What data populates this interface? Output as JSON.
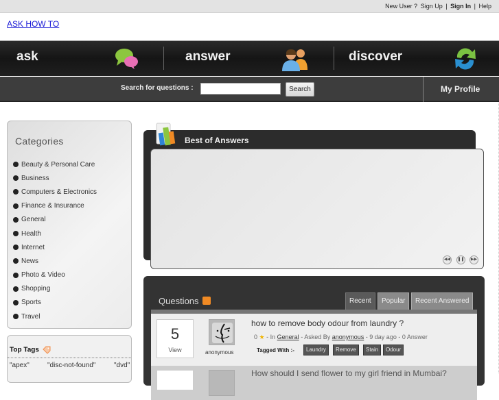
{
  "topbar": {
    "new_user": "New User ?",
    "sign_up": "Sign Up",
    "sep": "|",
    "sign_in": "Sign In",
    "help": "Help"
  },
  "brand": "ASK HOW TO",
  "nav": {
    "items": [
      {
        "label": "ask",
        "icon": "chat-bubbles-icon"
      },
      {
        "label": "answer",
        "icon": "users-icon"
      },
      {
        "label": "discover",
        "icon": "refresh-icon"
      }
    ]
  },
  "search": {
    "label": "Search for questions :",
    "value": "",
    "placeholder": "",
    "button": "Search",
    "profile": "My Profile"
  },
  "sidebar": {
    "categories_title": "Categories",
    "categories": [
      "Beauty & Personal Care",
      "Business",
      "Computers & Electronics",
      "Finance & Insurance",
      "General",
      "Health",
      "Internet",
      "News",
      "Photo & Video",
      "Shopping",
      "Sports",
      "Travel"
    ],
    "top_tags_title": "Top Tags",
    "top_tags": [
      "\"apex\"",
      "\"disc-not-found\"",
      "\"dvd\""
    ]
  },
  "best_of_answers": {
    "title": "Best of Answers",
    "controls": [
      "prev",
      "pause",
      "next"
    ]
  },
  "questions": {
    "title": "Questions",
    "tabs": [
      "Recent",
      "Popular",
      "Recent Answered"
    ],
    "active_tab": "Recent",
    "items": [
      {
        "views": "5",
        "views_label": "View",
        "user": "anonymous",
        "title": "how to remove body odour from laundry ?",
        "rating": "0",
        "in_label": "- In",
        "category": "General",
        "asked_by_label": "- Asked By",
        "asker": "anonymous",
        "age": "- 9 day ago - 0 Answer",
        "tagged_label": "Tagged With :-",
        "tags": [
          "Laundry",
          "Remove",
          "Stain",
          "Odour"
        ]
      },
      {
        "title": "How should I send flower to my girl friend in Mumbai?"
      }
    ]
  }
}
